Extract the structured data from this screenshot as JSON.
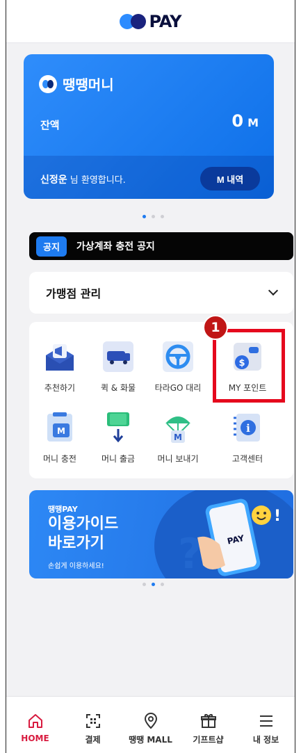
{
  "header": {
    "logo_text": "PAY"
  },
  "money_card": {
    "title": "땡땡머니",
    "balance_label": "잔액",
    "balance_value": "0",
    "balance_unit": "M",
    "user_name": "신정운",
    "greeting_suffix": "님 환영합니다.",
    "history_button": "M 내역",
    "accent": "#1e7bf0"
  },
  "notice": {
    "tag": "공지",
    "text": "가상계좌 충전 공지"
  },
  "merchant": {
    "label": "가맹점 관리"
  },
  "menu": {
    "row1": [
      {
        "label": "추천하기",
        "icon": "megaphone-icon"
      },
      {
        "label": "퀵 & 화물",
        "icon": "truck-icon"
      },
      {
        "label": "타라GO 대리",
        "icon": "steering-wheel-icon"
      },
      {
        "label": "MY 포인트",
        "icon": "wallet-points-icon"
      }
    ],
    "row2": [
      {
        "label": "머니 충전",
        "icon": "money-charge-icon"
      },
      {
        "label": "머니 출금",
        "icon": "money-withdraw-icon"
      },
      {
        "label": "머니 보내기",
        "icon": "money-send-icon"
      },
      {
        "label": "고객센터",
        "icon": "info-notebook-icon"
      }
    ]
  },
  "guide_banner": {
    "small": "땡땡PAY",
    "title_line1": "이용가이드",
    "title_line2": "바로가기",
    "sub": "손쉽게 이용하세요!",
    "phone_text": "PAY"
  },
  "annotation": {
    "badge": "1"
  },
  "tabs": [
    {
      "label": "HOME",
      "icon": "home-icon",
      "active": true
    },
    {
      "label": "결제",
      "icon": "scan-icon"
    },
    {
      "label": "땡땡 MALL",
      "icon": "location-pin-icon"
    },
    {
      "label": "기프트샵",
      "icon": "gift-icon"
    },
    {
      "label": "내 정보",
      "icon": "menu-icon"
    }
  ]
}
